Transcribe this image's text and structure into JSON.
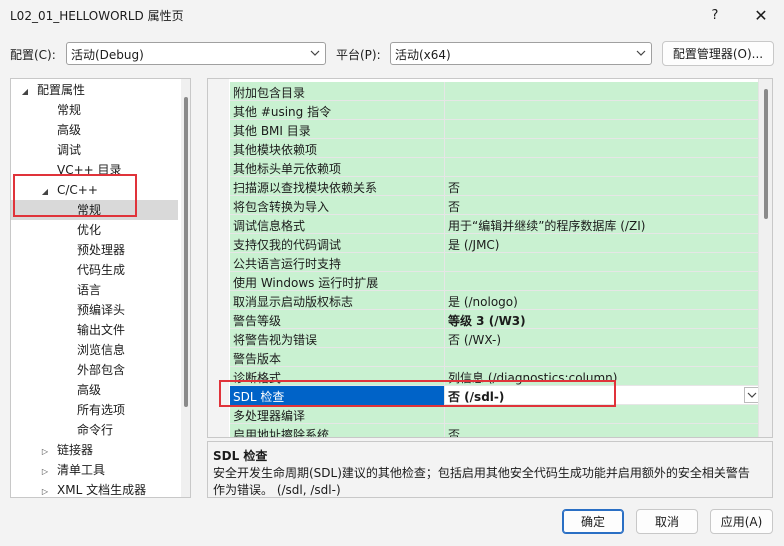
{
  "window": {
    "title": "L02_01_HELLOWORLD 属性页",
    "help_label": "?",
    "close_label": "✕"
  },
  "toolbar": {
    "config_label": "配置(C):",
    "config_value": "活动(Debug)",
    "platform_label": "平台(P):",
    "platform_value": "活动(x64)",
    "config_manager_label": "配置管理器(O)..."
  },
  "tree": {
    "items": [
      {
        "label": "配置属性",
        "indent": 0,
        "expanded": true
      },
      {
        "label": "常规",
        "indent": 1
      },
      {
        "label": "高级",
        "indent": 1
      },
      {
        "label": "调试",
        "indent": 1
      },
      {
        "label": "VC++ 目录",
        "indent": 1
      },
      {
        "label": "C/C++",
        "indent": 1,
        "expanded": true
      },
      {
        "label": "常规",
        "indent": 2,
        "selected": true
      },
      {
        "label": "优化",
        "indent": 2
      },
      {
        "label": "预处理器",
        "indent": 2
      },
      {
        "label": "代码生成",
        "indent": 2
      },
      {
        "label": "语言",
        "indent": 2
      },
      {
        "label": "预编译头",
        "indent": 2
      },
      {
        "label": "输出文件",
        "indent": 2
      },
      {
        "label": "浏览信息",
        "indent": 2
      },
      {
        "label": "外部包含",
        "indent": 2
      },
      {
        "label": "高级",
        "indent": 2
      },
      {
        "label": "所有选项",
        "indent": 2
      },
      {
        "label": "命令行",
        "indent": 2
      },
      {
        "label": "链接器",
        "indent": 1,
        "expanded": false
      },
      {
        "label": "清单工具",
        "indent": 1,
        "expanded": false
      },
      {
        "label": "XML 文档生成器",
        "indent": 1,
        "expanded": false
      }
    ]
  },
  "properties": [
    {
      "name": "附加包含目录",
      "value": ""
    },
    {
      "name": "其他 #using 指令",
      "value": ""
    },
    {
      "name": "其他 BMI 目录",
      "value": ""
    },
    {
      "name": "其他模块依赖项",
      "value": ""
    },
    {
      "name": "其他标头单元依赖项",
      "value": ""
    },
    {
      "name": "扫描源以查找模块依赖关系",
      "value": "否"
    },
    {
      "name": "将包含转换为导入",
      "value": "否"
    },
    {
      "name": "调试信息格式",
      "value": "用于“编辑并继续”的程序数据库 (/ZI)"
    },
    {
      "name": "支持仅我的代码调试",
      "value": "是 (/JMC)"
    },
    {
      "name": "公共语言运行时支持",
      "value": ""
    },
    {
      "name": "使用 Windows 运行时扩展",
      "value": ""
    },
    {
      "name": "取消显示启动版权标志",
      "value": "是 (/nologo)"
    },
    {
      "name": "警告等级",
      "value": "等级 3 (/W3)",
      "bold": true
    },
    {
      "name": "将警告视为错误",
      "value": "否 (/WX-)"
    },
    {
      "name": "警告版本",
      "value": ""
    },
    {
      "name": "诊断格式",
      "value": "列信息 (/diagnostics:column)"
    },
    {
      "name": "SDL 检查",
      "value": "否 (/sdl-)",
      "bold": true,
      "selected": true
    },
    {
      "name": "多处理器编译",
      "value": ""
    },
    {
      "name": "启用地址擦除系统",
      "value": "否"
    }
  ],
  "description": {
    "title": "SDL 检查",
    "text": "安全开发生命周期(SDL)建议的其他检查；包括启用其他安全代码生成功能并启用额外的安全相关警告作为错误。     (/sdl, /sdl-)"
  },
  "buttons": {
    "ok_label": "确定",
    "cancel_label": "取消",
    "apply_label": "应用(A)"
  },
  "colors": {
    "row_bg": "#c9f1d1",
    "selection": "#0063c8",
    "highlight_box": "#e0333a"
  }
}
